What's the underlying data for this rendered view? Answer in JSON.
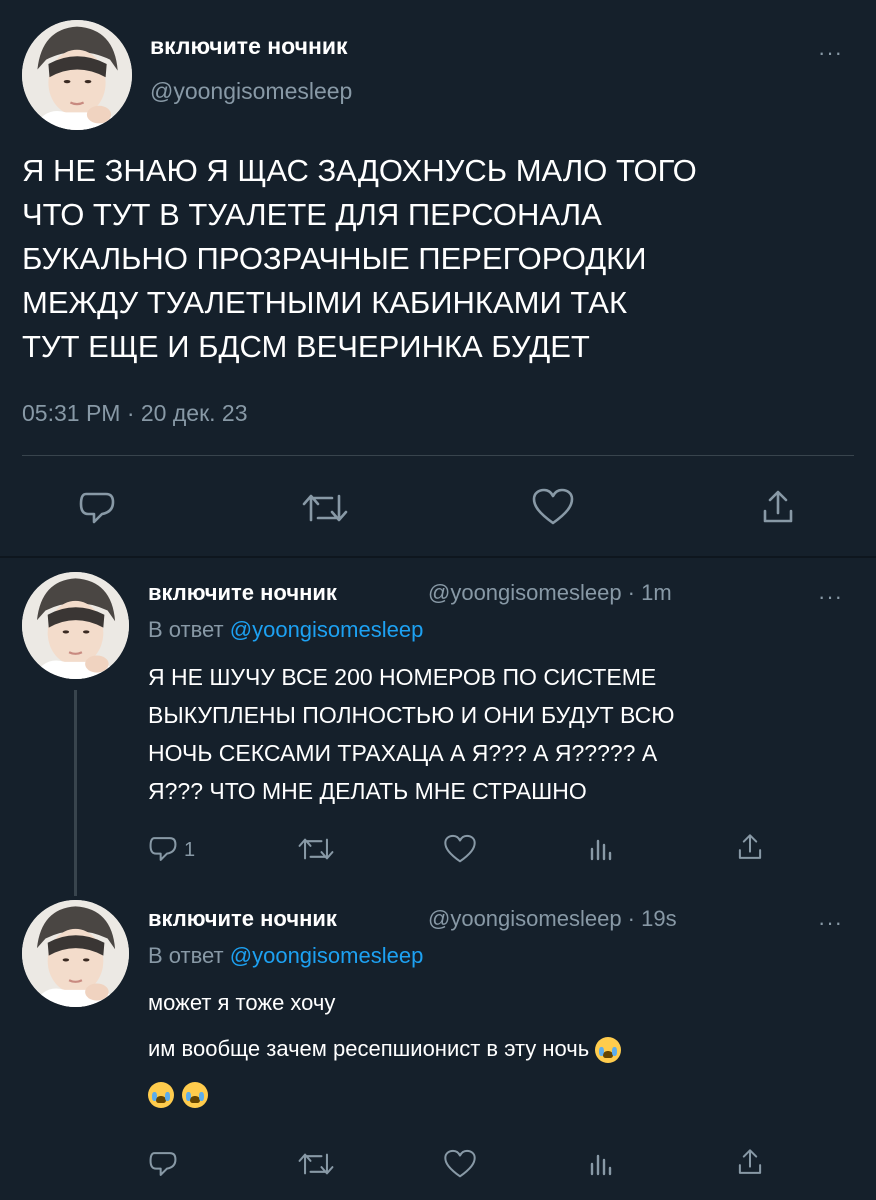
{
  "main_tweet": {
    "display_name": "включите ночник",
    "handle": "@yoongisomesleep",
    "text_lines": [
      "Я НЕ ЗНАЮ Я ЩАС ЗАДОХНУСЬ МАЛО ТОГО",
      "ЧТО ТУТ В ТУАЛЕТЕ ДЛЯ ПЕРСОНАЛА",
      "БУКАЛЬНО ПРОЗРАЧНЫЕ ПЕРЕГОРОДКИ",
      "МЕЖДУ ТУАЛЕТНЫМИ КАБИНКАМИ ТАК",
      "ТУТ ЕЩЕ И БДСМ ВЕЧЕРИНКА БУДЕТ"
    ],
    "timestamp": "05:31 PM · 20 дек. 23",
    "more": "···"
  },
  "reply_1": {
    "display_name": "включите ночник",
    "meta": "@yoongisomesleep · 1m",
    "reply_prefix": "В ответ",
    "reply_to": "@yoongisomesleep",
    "text_lines": [
      "Я НЕ ШУЧУ ВСЕ 200 НОМЕРОВ ПО СИСТЕМЕ",
      "ВЫКУПЛЕНЫ ПОЛНОСТЬЮ И ОНИ БУДУТ ВСЮ",
      "НОЧЬ СЕКСАМИ ТРАХАЦА А Я??? А Я????? А",
      "Я??? ЧТО МНЕ ДЕЛАТЬ МНЕ СТРАШНО"
    ],
    "reply_count": "1",
    "more": "···"
  },
  "reply_2": {
    "display_name": "включите ночник",
    "meta": "@yoongisomesleep · 19s",
    "reply_prefix": "В ответ",
    "reply_to": "@yoongisomesleep",
    "line_1": "может я тоже хочу",
    "line_2": "им вообще зачем ресепшионист в эту ночь",
    "more": "···"
  },
  "colors": {
    "background": "#15202b",
    "text": "#ffffff",
    "muted": "#8899a6",
    "accent": "#1da1f2",
    "divider": "#38444d"
  },
  "icons": [
    "reply-icon",
    "retweet-icon",
    "like-icon",
    "share-icon",
    "analytics-icon",
    "loudly-crying-face-emoji"
  ]
}
